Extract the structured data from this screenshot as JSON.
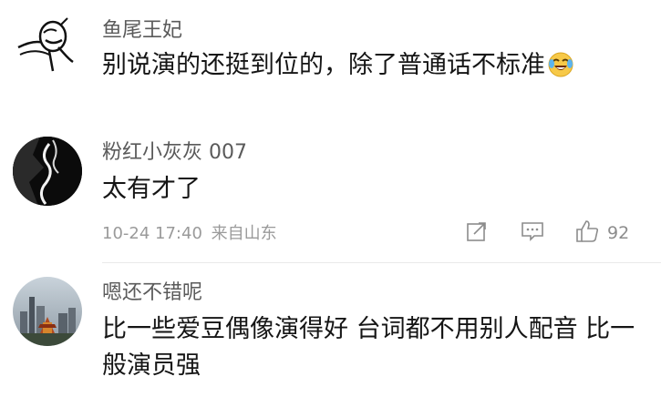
{
  "comments": [
    {
      "username": "鱼尾王妃",
      "text": "别说演的还挺到位的，除了普通话不标准",
      "emoji": "crying-laughing-emoji"
    },
    {
      "username": "粉红小灰灰 007",
      "text": "太有才了",
      "date": "10-24 17:40",
      "location": "来自山东",
      "like_count": "92"
    },
    {
      "username": "嗯还不错呢",
      "text_line1": "比一些爱豆偶像演得好 台词都不用别人配音 比一",
      "text_line2": "般演员强"
    }
  ],
  "icons": {
    "share": "share-icon",
    "comment": "comment-icon",
    "like": "thumbs-up-icon"
  }
}
